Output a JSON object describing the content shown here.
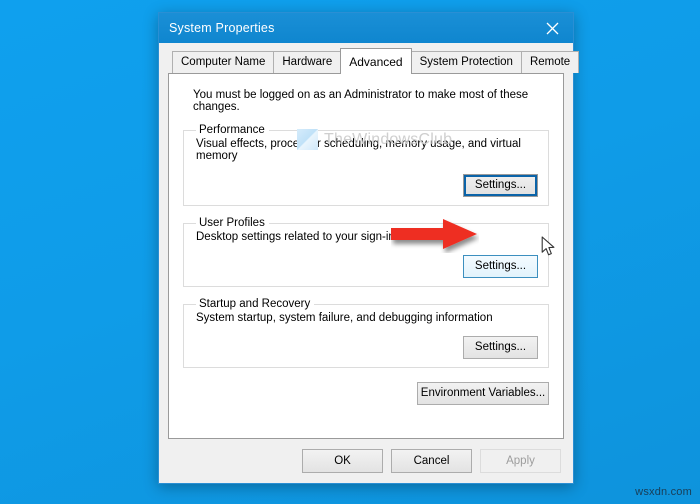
{
  "desktop": {
    "watermark": "wsxdn.com",
    "background_color": "#0f9ce8"
  },
  "dialog": {
    "title": "System Properties",
    "close_icon": "close-icon",
    "tabs": [
      {
        "label": "Computer Name",
        "selected": false
      },
      {
        "label": "Hardware",
        "selected": false
      },
      {
        "label": "Advanced",
        "selected": true
      },
      {
        "label": "System Protection",
        "selected": false
      },
      {
        "label": "Remote",
        "selected": false
      }
    ],
    "intro_text": "You must be logged on as an Administrator to make most of these changes.",
    "groups": [
      {
        "legend": "Performance",
        "description": "Visual effects, processor scheduling, memory usage, and virtual memory",
        "button_label": "Settings...",
        "button_state": "focused"
      },
      {
        "legend": "User Profiles",
        "description": "Desktop settings related to your sign-in",
        "button_label": "Settings...",
        "button_state": "hovered"
      },
      {
        "legend": "Startup and Recovery",
        "description": "System startup, system failure, and debugging information",
        "button_label": "Settings...",
        "button_state": "normal"
      }
    ],
    "environment_variables_label": "Environment Variables...",
    "footer": {
      "ok_label": "OK",
      "cancel_label": "Cancel",
      "apply_label": "Apply",
      "apply_disabled": true
    },
    "watermark": {
      "text": "TheWindowsClub"
    },
    "annotation": {
      "arrow_color": "#ee2d24",
      "points_to": "User Profiles Settings button"
    }
  }
}
